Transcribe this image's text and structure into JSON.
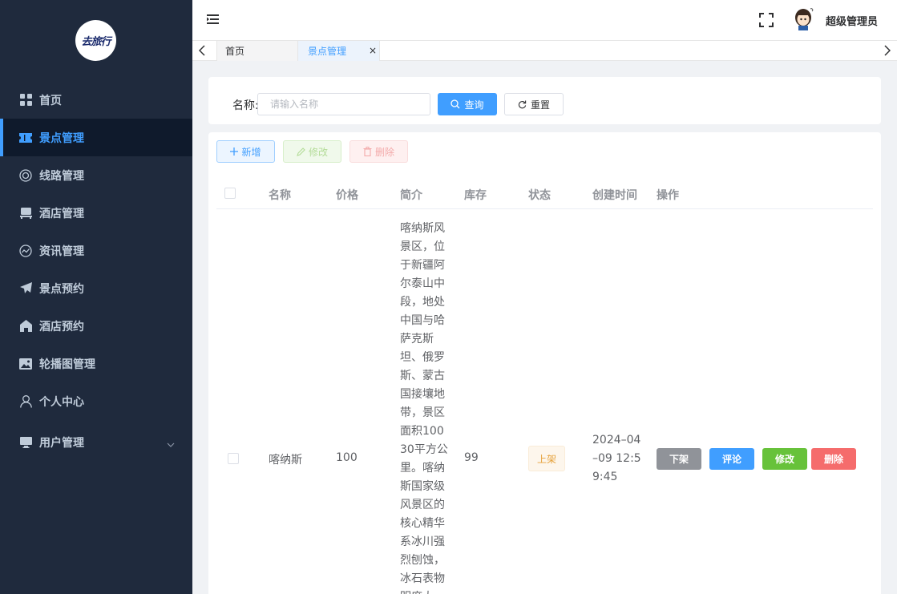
{
  "logo": {
    "text": "去旅行"
  },
  "sidebar": {
    "items": [
      {
        "label": "首页",
        "icon": "grid-icon"
      },
      {
        "label": "景点管理",
        "icon": "ticket-icon",
        "active": true
      },
      {
        "label": "线路管理",
        "icon": "globe-icon"
      },
      {
        "label": "酒店管理",
        "icon": "bed-icon"
      },
      {
        "label": "资讯管理",
        "icon": "chart-circle-icon"
      },
      {
        "label": "景点预约",
        "icon": "send-icon"
      },
      {
        "label": "酒店预约",
        "icon": "house-icon"
      },
      {
        "label": "轮播图管理",
        "icon": "picture-icon"
      },
      {
        "label": "个人中心",
        "icon": "user-icon"
      },
      {
        "label": "用户管理",
        "icon": "monitor-icon"
      }
    ]
  },
  "header": {
    "user_name": "超级管理员"
  },
  "tags": [
    {
      "label": "首页"
    },
    {
      "label": "景点管理",
      "close": "×"
    }
  ],
  "search": {
    "label": "名称:",
    "placeholder": "请输入名称",
    "query_label": "查询",
    "reset_label": "重置"
  },
  "toolbar": {
    "add_label": "新增",
    "edit_label": "修改",
    "delete_label": "删除"
  },
  "table": {
    "columns": [
      "名称",
      "价格",
      "简介",
      "库存",
      "状态",
      "创建时间",
      "操作"
    ],
    "rows": [
      {
        "name": "喀纳斯",
        "price": "100",
        "desc": "喀纳斯风景区，位于新疆阿尔泰山中段，地处中国与哈萨克斯坦、俄罗斯、蒙古国接壤地带，景区面积10030平方公里。喀纳斯国家级风景区的核心精华系冰川强烈刨蚀，冰石表物明度大",
        "stock": "99",
        "status": "上架",
        "created": "2024–04–09 12:59:45",
        "actions": {
          "down": "下架",
          "comment": "评论",
          "edit": "修改",
          "delete": "删除"
        }
      }
    ]
  },
  "colors": {
    "primary": "#409eff",
    "sidebar_bg": "#1f2a3d",
    "success": "#67c23a",
    "danger": "#f56c6c",
    "warning": "#e6a23c",
    "info": "#909399"
  }
}
